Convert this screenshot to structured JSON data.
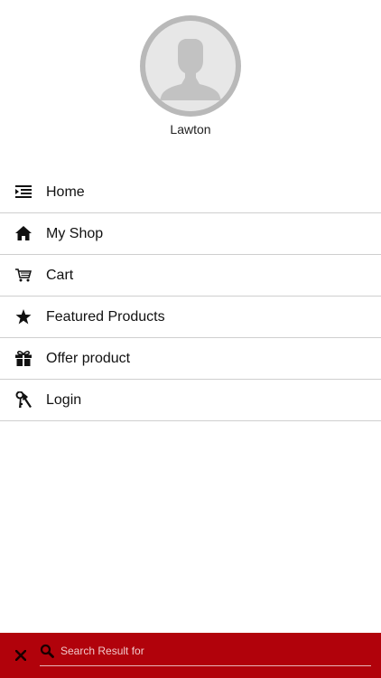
{
  "profile": {
    "username": "Lawton",
    "avatar_icon": "user-avatar-icon"
  },
  "menu": {
    "items": [
      {
        "label": "Home",
        "icon": "menu-indent-icon"
      },
      {
        "label": "My Shop",
        "icon": "home-icon"
      },
      {
        "label": "Cart",
        "icon": "cart-icon"
      },
      {
        "label": "Featured Products",
        "icon": "star-icon"
      },
      {
        "label": "Offer product",
        "icon": "gift-icon"
      },
      {
        "label": "Login",
        "icon": "keys-icon"
      }
    ]
  },
  "search_bar": {
    "placeholder": "Search Result for",
    "value": "",
    "background": "#b1020b"
  }
}
